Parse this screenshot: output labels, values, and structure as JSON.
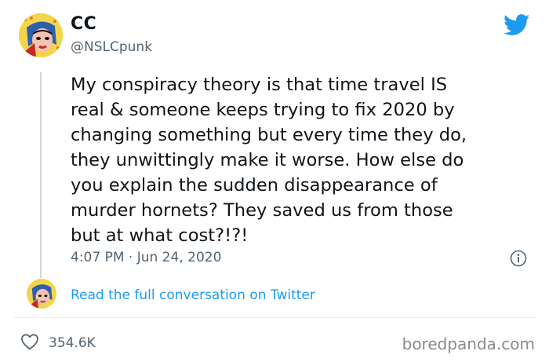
{
  "tweet": {
    "display_name": "CC",
    "handle": "@NSLCpunk",
    "text": "My conspiracy theory is that time travel IS\nreal & someone keeps trying to fix 2020 by\nchanging something but every time they do,\nthey unwittingly make it worse. How else do\nyou explain the sudden disappearance of\nmurder hornets? They saved us from those\nbut at what cost?!?!",
    "time": "4:07 PM",
    "separator": "·",
    "date": "Jun 24, 2020",
    "read_link": "Read the full conversation on Twitter",
    "likes": "354.6K"
  },
  "watermark": "boredpanda.com",
  "icons": {
    "brand": "twitter-bird-icon",
    "info": "info-icon",
    "like": "heart-icon"
  },
  "colors": {
    "text": "#0f1419",
    "muted": "#536471",
    "link": "#1d9bf0",
    "twitter_blue": "#1d9bf0"
  }
}
